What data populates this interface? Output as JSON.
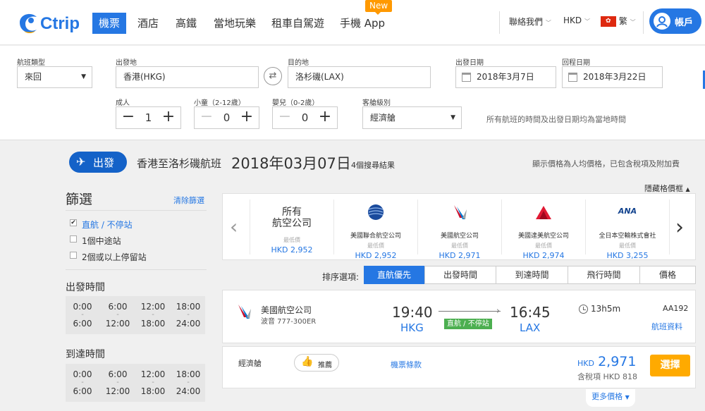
{
  "brand": {
    "name": "Ctrip"
  },
  "nav": {
    "tabs": [
      {
        "label": "機票",
        "active": true
      },
      {
        "label": "酒店"
      },
      {
        "label": "高鐵"
      },
      {
        "label": "當地玩樂"
      },
      {
        "label": "租車自駕遊"
      },
      {
        "label": "手機 App"
      }
    ],
    "new_badge": "New",
    "contact": "聯絡我們",
    "currency": "HKD",
    "language": "繁",
    "account": "帳戶"
  },
  "search": {
    "trip_type_label": "航班類型",
    "trip_type_value": "來回",
    "from_label": "出發地",
    "from_value": "香港(HKG)",
    "to_label": "目的地",
    "to_value": "洛杉磯(LAX)",
    "depart_label": "出發日期",
    "depart_value": "2018年3月7日",
    "return_label": "回程日期",
    "return_value": "2018年3月22日",
    "adult_label": "成人",
    "adult_value": "1",
    "child_label": "小童（2-12歲）",
    "child_value": "0",
    "infant_label": "嬰兒（0-2歲）",
    "infant_value": "0",
    "cabin_label": "客艙級別",
    "cabin_value": "經濟艙",
    "note": "所有航班的時間及出發日期均為當地時間"
  },
  "results": {
    "departure_button": "出發",
    "route_title": "香港至洛杉磯航班",
    "date": "2018年03月07日",
    "count": "4個搜尋結果",
    "price_note": "顯示價格為人均價格，已包含稅項及附加費",
    "hide_grid": "隱藏格價框"
  },
  "filters": {
    "title": "篩選",
    "clear": "清除篩選",
    "stops": [
      {
        "label": "直航 / 不停站",
        "checked": true
      },
      {
        "label": "1個中途站",
        "checked": false
      },
      {
        "label": "2個或以上停留站",
        "checked": false
      }
    ],
    "departure_time_title": "出發時間",
    "arrival_time_title": "到達時間",
    "time_slots": [
      {
        "start": "0:00",
        "dash": "-",
        "end": "6:00"
      },
      {
        "start": "6:00",
        "dash": "-",
        "end": "12:00"
      },
      {
        "start": "12:00",
        "dash": "-",
        "end": "18:00"
      },
      {
        "start": "18:00",
        "dash": "-",
        "end": "24:00"
      }
    ]
  },
  "airlines": {
    "all_line1": "所有",
    "all_line2": "航空公司",
    "lowest_label": "最低價",
    "items": [
      {
        "name": "所有航空公司",
        "price": "HKD 2,952"
      },
      {
        "name": "美國聯合航空公司",
        "price": "HKD 2,952",
        "logo": "united-logo",
        "color": "#1a4a9c"
      },
      {
        "name": "美國航空公司",
        "price": "HKD 2,971",
        "logo": "american-logo",
        "color": "#c8102e"
      },
      {
        "name": "美國達美航空公司",
        "price": "HKD 2,974",
        "logo": "delta-logo",
        "color": "#e01933"
      },
      {
        "name": "全日本空輸株式會社",
        "price": "HKD 3,255",
        "logo": "ana-logo",
        "text": "ANA",
        "color": "#13448f"
      }
    ]
  },
  "sort": {
    "label": "排序選項:",
    "options": [
      "直航優先",
      "出發時間",
      "到達時間",
      "飛行時間",
      "價格"
    ],
    "active_index": 0
  },
  "flight": {
    "airline": "美國航空公司",
    "aircraft": "波音 777-300ER",
    "depart_time": "19:40",
    "depart_airport": "HKG",
    "arrive_time": "16:45",
    "arrive_airport": "LAX",
    "stop_badge": "直航 / 不停站",
    "duration": "13h5m",
    "flight_no": "AA192",
    "details_link": "航班資料",
    "cabin": "經濟艙",
    "recommend": "推薦",
    "fare_rules": "機票條款",
    "currency": "HKD",
    "price": "2,971",
    "tax_note": "含稅項 HKD 818",
    "select": "選擇",
    "more_prices": "更多價格"
  },
  "colors": {
    "accent": "#2577e3",
    "select": "#ffaa00",
    "green": "#4caf50"
  }
}
